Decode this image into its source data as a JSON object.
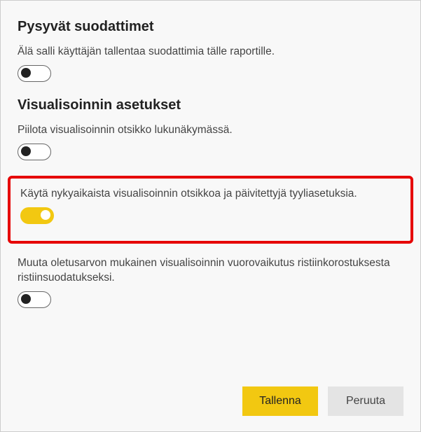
{
  "sections": {
    "persistent_filters": {
      "title": "Pysyvät suodattimet",
      "setting1": {
        "label": "Älä salli käyttäjän tallentaa suodattimia tälle raportille.",
        "on": false
      }
    },
    "visual_settings": {
      "title": "Visualisoinnin asetukset",
      "setting1": {
        "label": "Piilota visualisoinnin otsikko lukunäkymässä.",
        "on": false
      },
      "setting2": {
        "label": "Käytä nykyaikaista visualisoinnin otsikkoa ja päivitettyjä tyyliasetuksia.",
        "on": true
      },
      "setting3": {
        "label": "Muuta oletusarvon mukainen visualisoinnin vuorovaikutus ristiinkorostuksesta ristiinsuodatukseksi.",
        "on": false
      }
    }
  },
  "buttons": {
    "save": "Tallenna",
    "cancel": "Peruuta"
  }
}
